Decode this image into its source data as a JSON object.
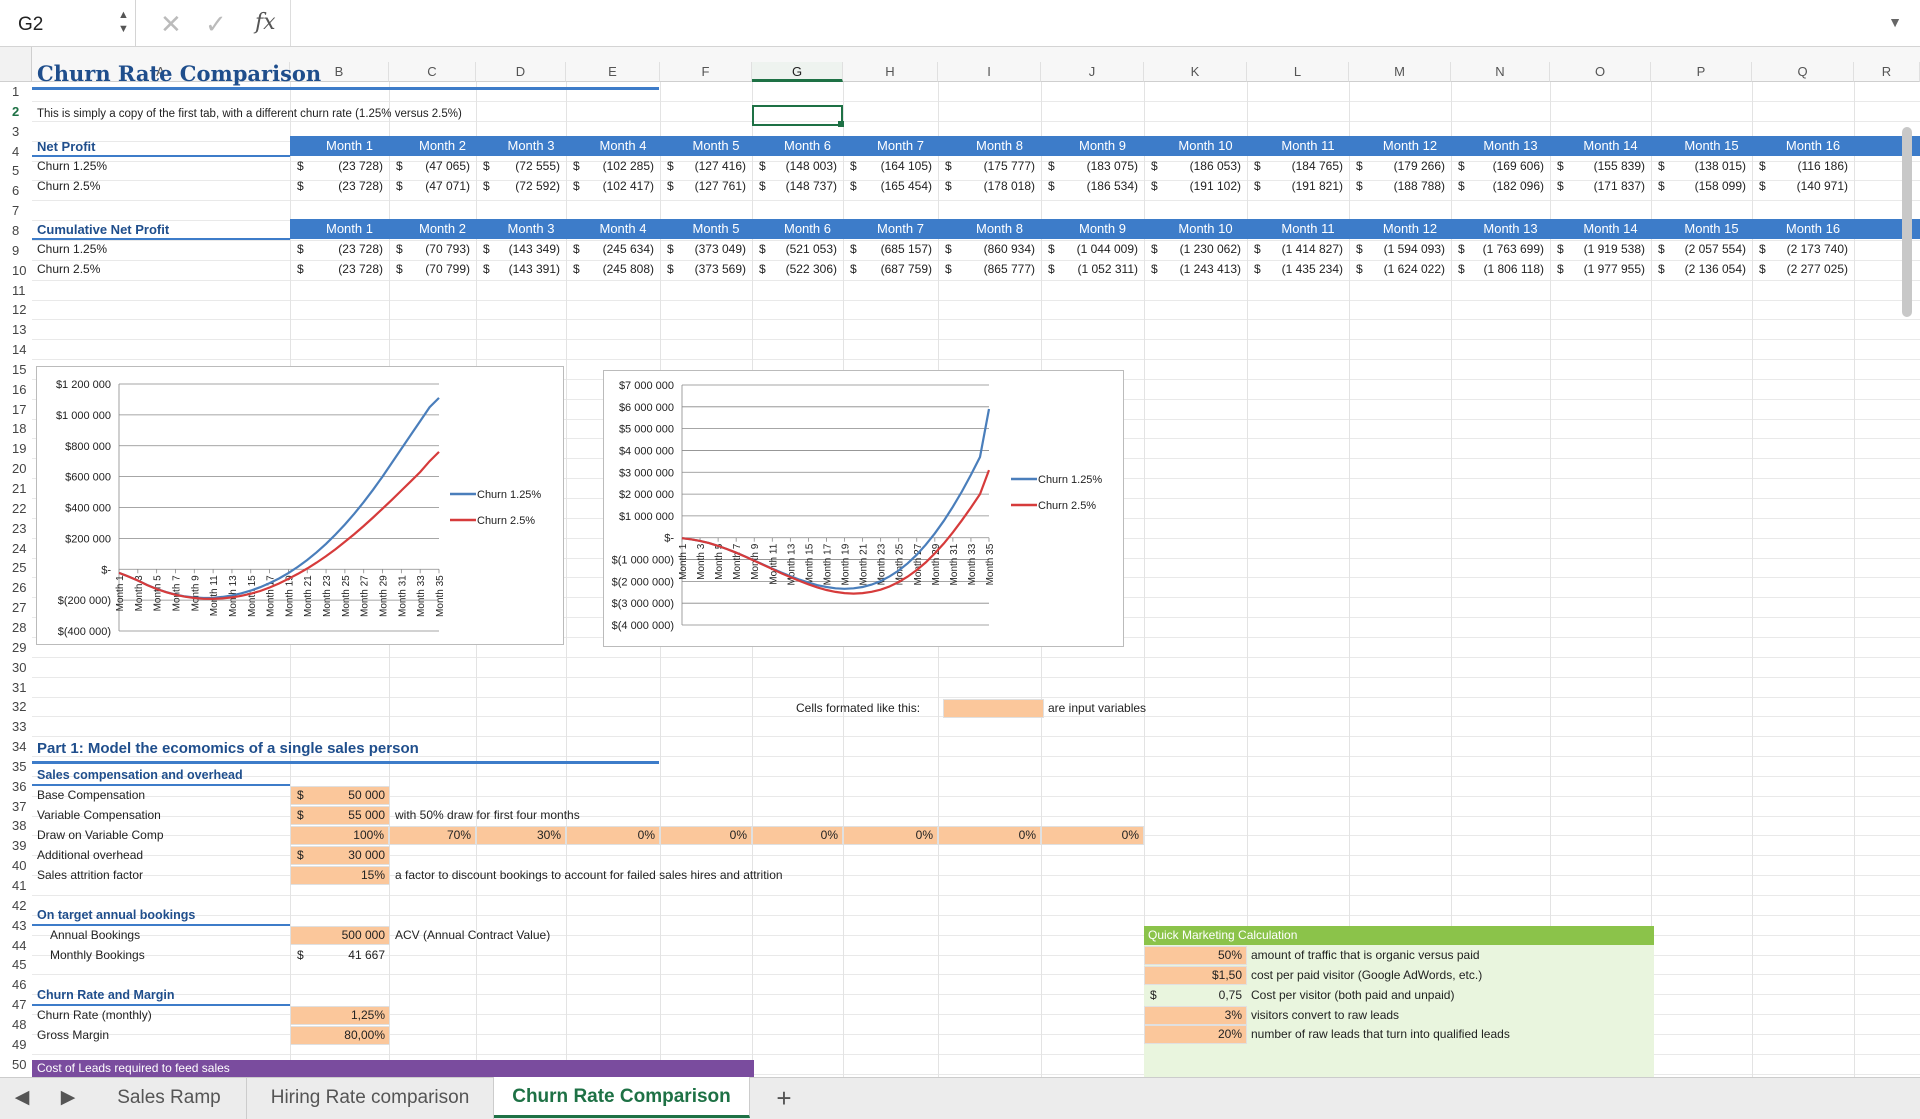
{
  "formula_bar": {
    "name_box": "G2",
    "fx": "fx"
  },
  "columns": [
    "A",
    "B",
    "C",
    "D",
    "E",
    "F",
    "G",
    "H",
    "I",
    "J",
    "K",
    "L",
    "M",
    "N",
    "O",
    "P",
    "Q",
    "R"
  ],
  "selected_column": "G",
  "selected_row": "2",
  "title": "Churn Rate Comparison",
  "note": "This is simply a copy of the first tab, with a different churn rate (1.25% versus 2.5%)",
  "net_profit": {
    "header": "Net Profit",
    "months": [
      "Month 1",
      "Month 2",
      "Month 3",
      "Month 4",
      "Month 5",
      "Month 6",
      "Month 7",
      "Month 8",
      "Month 9",
      "Month 10",
      "Month 11",
      "Month 12",
      "Month 13",
      "Month 14",
      "Month 15",
      "Month 16"
    ],
    "rows": [
      {
        "label": "Churn 1.25%",
        "values": [
          "(23 728)",
          "(47 065)",
          "(72 555)",
          "(102 285)",
          "(127 416)",
          "(148 003)",
          "(164 105)",
          "(175 777)",
          "(183 075)",
          "(186 053)",
          "(184 765)",
          "(179 266)",
          "(169 606)",
          "(155 839)",
          "(138 015)",
          "(116 186)"
        ]
      },
      {
        "label": "Churn 2.5%",
        "values": [
          "(23 728)",
          "(47 071)",
          "(72 592)",
          "(102 417)",
          "(127 761)",
          "(148 737)",
          "(165 454)",
          "(178 018)",
          "(186 534)",
          "(191 102)",
          "(191 821)",
          "(188 788)",
          "(182 096)",
          "(171 837)",
          "(158 099)",
          "(140 971)"
        ]
      }
    ]
  },
  "cum_profit": {
    "header": "Cumulative Net Profit",
    "rows": [
      {
        "label": "Churn 1.25%",
        "values": [
          "(23 728)",
          "(70 793)",
          "(143 349)",
          "(245 634)",
          "(373 049)",
          "(521 053)",
          "(685 157)",
          "(860 934)",
          "(1 044 009)",
          "(1 230 062)",
          "(1 414 827)",
          "(1 594 093)",
          "(1 763 699)",
          "(1 919 538)",
          "(2 057 554)",
          "(2 173 740)"
        ]
      },
      {
        "label": "Churn 2.5%",
        "values": [
          "(23 728)",
          "(70 799)",
          "(143 391)",
          "(245 808)",
          "(373 569)",
          "(522 306)",
          "(687 759)",
          "(865 777)",
          "(1 052 311)",
          "(1 243 413)",
          "(1 435 234)",
          "(1 624 022)",
          "(1 806 118)",
          "(1 977 955)",
          "(2 136 054)",
          "(2 277 025)"
        ]
      }
    ]
  },
  "currency": "$",
  "legend_note": {
    "label": "Cells formated like this:",
    "text": "are input variables"
  },
  "part1": {
    "title": "Part 1: Model the ecomomics of a single sales person",
    "sc_header": "Sales compensation and overhead",
    "base_label": "Base Compensation",
    "base_val": "50 000",
    "var_label": "Variable Compensation",
    "var_val": "55 000",
    "var_note": "with 50% draw for first four months",
    "draw_label": "Draw on Variable Comp",
    "draw_vals": [
      "100%",
      "70%",
      "30%",
      "0%",
      "0%",
      "0%",
      "0%",
      "0%",
      "0%"
    ],
    "over_label": "Additional overhead",
    "over_val": "30 000",
    "attr_label": "Sales attrition factor",
    "attr_val": "15%",
    "attr_note": "a factor to discount bookings to account for failed sales hires and attrition",
    "book_header": "On target annual  bookings",
    "annual_label": "Annual Bookings",
    "annual_val": "500 000",
    "annual_note": "ACV (Annual Contract Value)",
    "monthly_label": "Monthly Bookings",
    "monthly_val": "41 667",
    "churn_header": "Churn Rate and Margin",
    "churn_label": "Churn Rate (monthly)",
    "churn_val": "1,25%",
    "margin_label": "Gross Margin",
    "margin_val": "80,00%",
    "leads_header": "Cost of Leads required to feed sales"
  },
  "qmc": {
    "title": "Quick Marketing Calculation",
    "rows": [
      {
        "val": "50%",
        "label": "amount of traffic that is organic versus paid"
      },
      {
        "val": "$1,50",
        "label": "cost per paid visitor (Google AdWords, etc.)"
      },
      {
        "val": "0,75",
        "label": "Cost per visitor (both paid and unpaid)"
      },
      {
        "val": "3%",
        "label": "visitors convert to raw leads"
      },
      {
        "val": "20%",
        "label": "number of raw leads that turn into qualified leads"
      }
    ]
  },
  "chart_data": [
    {
      "type": "line",
      "title": "",
      "yticks": [
        "$1 200 000",
        "$1 000 000",
        "$800 000",
        "$600 000",
        "$400 000",
        "$200 000",
        "$-",
        "$(200 000)",
        "$(400 000)"
      ],
      "ylim": [
        -400000,
        1200000
      ],
      "xticks": [
        "Month 1",
        "Month 3",
        "Month 5",
        "Month 7",
        "Month 9",
        "Month 11",
        "Month 13",
        "Month 15",
        "Month 17",
        "Month 19",
        "Month 21",
        "Month 23",
        "Month 25",
        "Month 27",
        "Month 29",
        "Month 31",
        "Month 33",
        "Month 35"
      ],
      "series": [
        {
          "name": "Churn 1.25%",
          "color": "#4a7ebb",
          "values": [
            -23728,
            -47065,
            -72555,
            -102285,
            -127416,
            -148003,
            -164105,
            -175777,
            -183075,
            -186053,
            -184765,
            -179266,
            -169606,
            -155839,
            -138015,
            -116186,
            -90000,
            -60000,
            -25000,
            15000,
            60000,
            110000,
            165000,
            225000,
            290000,
            360000,
            435000,
            515000,
            600000,
            690000,
            780000,
            870000,
            960000,
            1050000,
            1110000
          ]
        },
        {
          "name": "Churn 2.5%",
          "color": "#d63b3b",
          "values": [
            -23728,
            -47071,
            -72592,
            -102417,
            -127761,
            -148737,
            -165454,
            -178018,
            -186534,
            -191102,
            -191821,
            -188788,
            -182096,
            -171837,
            -158099,
            -140971,
            -118000,
            -92000,
            -62000,
            -30000,
            5000,
            43000,
            85000,
            130000,
            178000,
            228000,
            280000,
            335000,
            392000,
            450000,
            510000,
            570000,
            630000,
            700000,
            760000
          ]
        }
      ]
    },
    {
      "type": "line",
      "title": "",
      "yticks": [
        "$7 000 000",
        "$6 000 000",
        "$5 000 000",
        "$4 000 000",
        "$3 000 000",
        "$2 000 000",
        "$1 000 000",
        "$-",
        "$(1 000 000)",
        "$(2 000 000)",
        "$(3 000 000)",
        "$(4 000 000)"
      ],
      "ylim": [
        -4000000,
        7000000
      ],
      "xticks": [
        "Month 1",
        "Month 3",
        "Month 5",
        "Month 7",
        "Month 9",
        "Month 11",
        "Month 13",
        "Month 15",
        "Month 17",
        "Month 19",
        "Month 21",
        "Month 23",
        "Month 25",
        "Month 27",
        "Month 29",
        "Month 31",
        "Month 33",
        "Month 35"
      ],
      "series": [
        {
          "name": "Churn 1.25%",
          "color": "#4a7ebb",
          "values": [
            -23728,
            -70793,
            -143349,
            -245634,
            -373049,
            -521053,
            -685157,
            -860934,
            -1044009,
            -1230062,
            -1414827,
            -1594093,
            -1763699,
            -1919538,
            -2057554,
            -2173740,
            -2260000,
            -2320000,
            -2340000,
            -2320000,
            -2260000,
            -2150000,
            -1990000,
            -1770000,
            -1500000,
            -1170000,
            -780000,
            -320000,
            200000,
            780000,
            1420000,
            2120000,
            2880000,
            3700000,
            5900000
          ]
        },
        {
          "name": "Churn 2.5%",
          "color": "#d63b3b",
          "values": [
            -23728,
            -70799,
            -143391,
            -245808,
            -373569,
            -522306,
            -687759,
            -865777,
            -1052311,
            -1243413,
            -1435234,
            -1624022,
            -1806118,
            -1977955,
            -2136054,
            -2277025,
            -2395000,
            -2485000,
            -2540000,
            -2560000,
            -2540000,
            -2480000,
            -2380000,
            -2230000,
            -2030000,
            -1780000,
            -1480000,
            -1130000,
            -720000,
            -260000,
            250000,
            800000,
            1380000,
            2000000,
            3100000
          ]
        }
      ]
    }
  ],
  "tabs": [
    "Sales Ramp",
    "Hiring Rate comparison",
    "Churn Rate Comparison"
  ],
  "active_tab": "Churn Rate Comparison"
}
